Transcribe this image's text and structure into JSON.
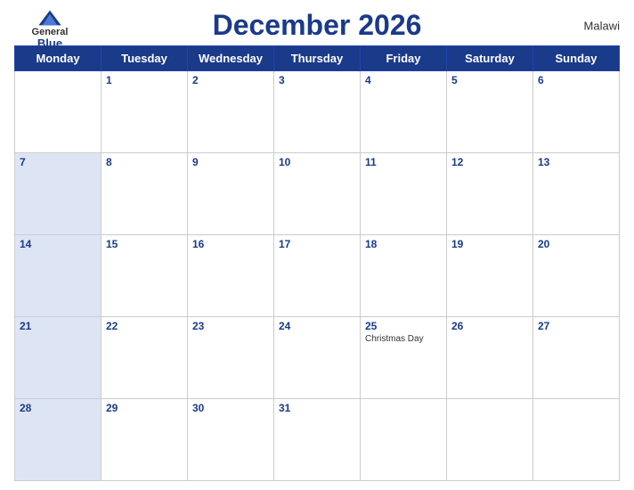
{
  "logo": {
    "general": "General",
    "blue": "Blue"
  },
  "country": "Malawi",
  "title": "December 2026",
  "days": [
    "Monday",
    "Tuesday",
    "Wednesday",
    "Thursday",
    "Friday",
    "Saturday",
    "Sunday"
  ],
  "weeks": [
    [
      {
        "num": "",
        "event": "",
        "blue": false
      },
      {
        "num": "1",
        "event": "",
        "blue": false
      },
      {
        "num": "2",
        "event": "",
        "blue": false
      },
      {
        "num": "3",
        "event": "",
        "blue": false
      },
      {
        "num": "4",
        "event": "",
        "blue": false
      },
      {
        "num": "5",
        "event": "",
        "blue": false
      },
      {
        "num": "6",
        "event": "",
        "blue": false
      }
    ],
    [
      {
        "num": "7",
        "event": "",
        "blue": true
      },
      {
        "num": "8",
        "event": "",
        "blue": false
      },
      {
        "num": "9",
        "event": "",
        "blue": false
      },
      {
        "num": "10",
        "event": "",
        "blue": false
      },
      {
        "num": "11",
        "event": "",
        "blue": false
      },
      {
        "num": "12",
        "event": "",
        "blue": false
      },
      {
        "num": "13",
        "event": "",
        "blue": false
      }
    ],
    [
      {
        "num": "14",
        "event": "",
        "blue": true
      },
      {
        "num": "15",
        "event": "",
        "blue": false
      },
      {
        "num": "16",
        "event": "",
        "blue": false
      },
      {
        "num": "17",
        "event": "",
        "blue": false
      },
      {
        "num": "18",
        "event": "",
        "blue": false
      },
      {
        "num": "19",
        "event": "",
        "blue": false
      },
      {
        "num": "20",
        "event": "",
        "blue": false
      }
    ],
    [
      {
        "num": "21",
        "event": "",
        "blue": true
      },
      {
        "num": "22",
        "event": "",
        "blue": false
      },
      {
        "num": "23",
        "event": "",
        "blue": false
      },
      {
        "num": "24",
        "event": "",
        "blue": false
      },
      {
        "num": "25",
        "event": "Christmas Day",
        "blue": false
      },
      {
        "num": "26",
        "event": "",
        "blue": false
      },
      {
        "num": "27",
        "event": "",
        "blue": false
      }
    ],
    [
      {
        "num": "28",
        "event": "",
        "blue": true
      },
      {
        "num": "29",
        "event": "",
        "blue": false
      },
      {
        "num": "30",
        "event": "",
        "blue": false
      },
      {
        "num": "31",
        "event": "",
        "blue": false
      },
      {
        "num": "",
        "event": "",
        "blue": false
      },
      {
        "num": "",
        "event": "",
        "blue": false
      },
      {
        "num": "",
        "event": "",
        "blue": false
      }
    ]
  ]
}
